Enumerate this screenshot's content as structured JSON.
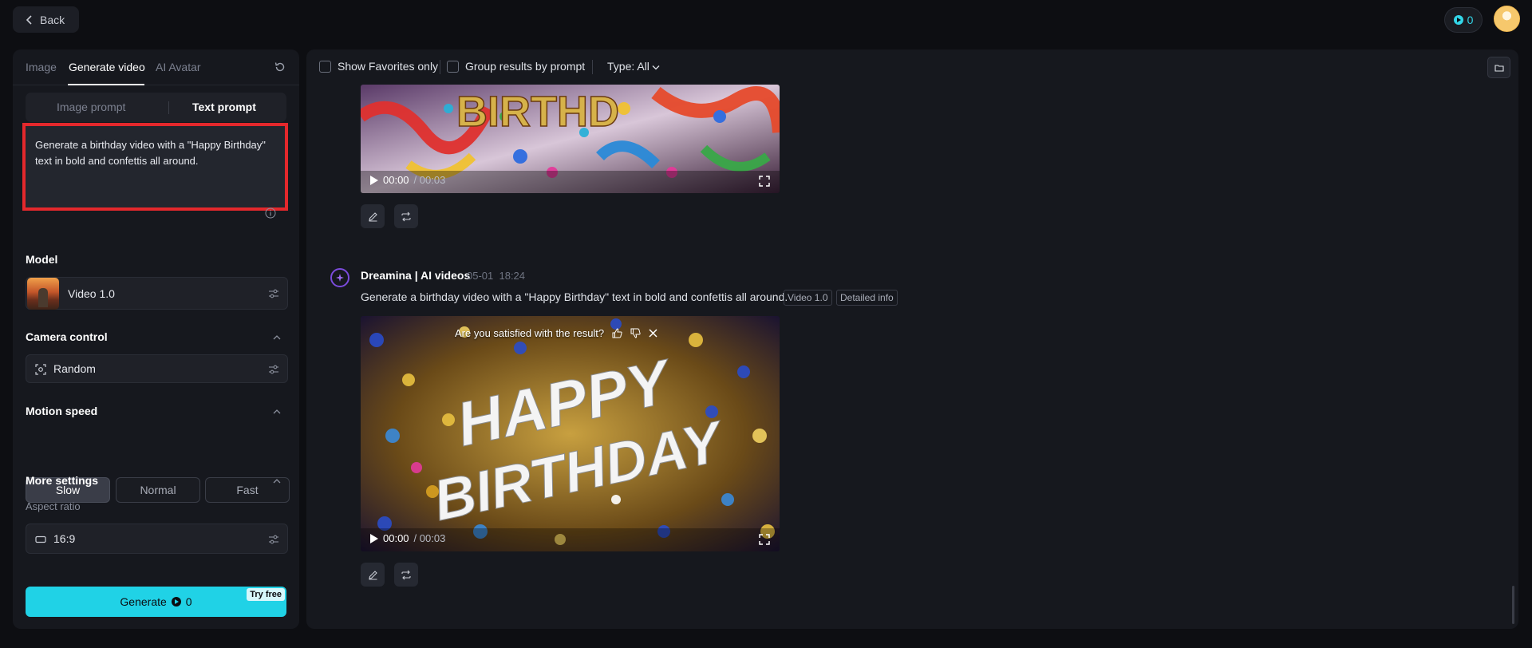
{
  "topbar": {
    "back_label": "Back",
    "credits": "0"
  },
  "left": {
    "tabs": [
      "Image",
      "Generate video",
      "AI Avatar"
    ],
    "prompt_modes": [
      "Image prompt",
      "Text prompt"
    ],
    "prompt_text": "Generate a birthday video with a \"Happy Birthday\" text in bold and confettis all around.",
    "model_label": "Model",
    "model_value": "Video 1.0",
    "camera_label": "Camera control",
    "camera_value": "Random",
    "motion_label": "Motion speed",
    "speeds": [
      "Slow",
      "Normal",
      "Fast"
    ],
    "selected_speed": "Slow",
    "more_label": "More settings",
    "aspect_label": "Aspect ratio",
    "aspect_value": "16:9",
    "generate_label": "Generate",
    "generate_cost": "0",
    "try_free": "Try free"
  },
  "main": {
    "show_favorites": "Show Favorites only",
    "group_results": "Group results by prompt",
    "type_filter": "Type: All",
    "video1": {
      "time": "00:00",
      "duration": "/ 00:03"
    },
    "generation": {
      "author": "Dreamina | AI videos",
      "date": "05-01",
      "time": "18:24",
      "prompt": "Generate a birthday video with a \"Happy Birthday\" text in bold and confettis all around.",
      "tags": [
        "Video 1.0",
        "Detailed info"
      ],
      "satisfaction_question": "Are you satisfied with the result?",
      "video_time": "00:00",
      "video_duration": "/ 00:03",
      "overlay_line1": "HAPPY",
      "overlay_line2": "BIRTHDAY",
      "top_video_text": "BIRTHD"
    }
  },
  "colors": {
    "accent": "#20d2e6",
    "highlight": "#e4282c",
    "background": "#0d0e12",
    "panel": "#16181e"
  },
  "icons": [
    "chevron-left-icon",
    "coin-icon",
    "user-avatar",
    "reset-icon",
    "info-icon",
    "sliders-icon",
    "focus-icon",
    "chevron-up-icon",
    "folder-icon",
    "play-icon",
    "fullscreen-icon",
    "edit-icon",
    "repeat-icon",
    "thumbs-up-icon",
    "thumbs-down-icon",
    "close-icon"
  ]
}
